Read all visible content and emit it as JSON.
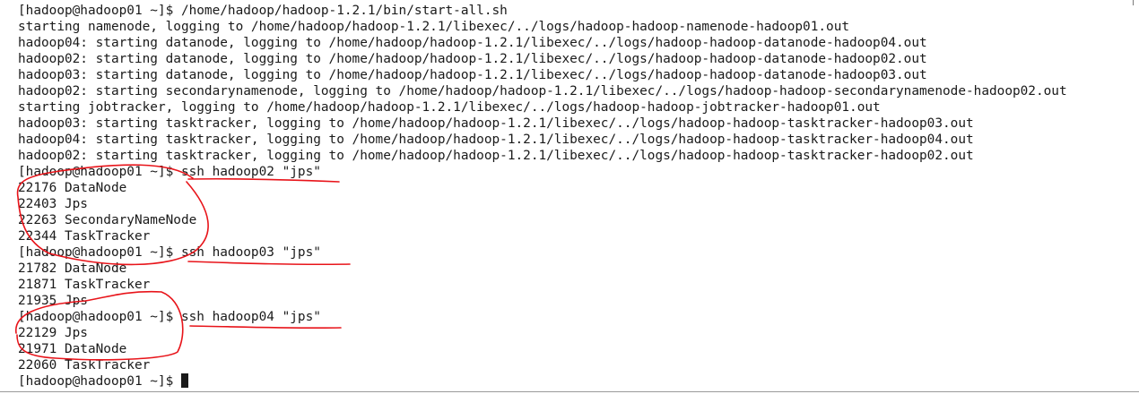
{
  "terminal": {
    "lines": [
      "[hadoop@hadoop01 ~]$ /home/hadoop/hadoop-1.2.1/bin/start-all.sh",
      "starting namenode, logging to /home/hadoop/hadoop-1.2.1/libexec/../logs/hadoop-hadoop-namenode-hadoop01.out",
      "hadoop04: starting datanode, logging to /home/hadoop/hadoop-1.2.1/libexec/../logs/hadoop-hadoop-datanode-hadoop04.out",
      "hadoop02: starting datanode, logging to /home/hadoop/hadoop-1.2.1/libexec/../logs/hadoop-hadoop-datanode-hadoop02.out",
      "hadoop03: starting datanode, logging to /home/hadoop/hadoop-1.2.1/libexec/../logs/hadoop-hadoop-datanode-hadoop03.out",
      "hadoop02: starting secondarynamenode, logging to /home/hadoop/hadoop-1.2.1/libexec/../logs/hadoop-hadoop-secondarynamenode-hadoop02.out",
      "starting jobtracker, logging to /home/hadoop/hadoop-1.2.1/libexec/../logs/hadoop-hadoop-jobtracker-hadoop01.out",
      "hadoop03: starting tasktracker, logging to /home/hadoop/hadoop-1.2.1/libexec/../logs/hadoop-hadoop-tasktracker-hadoop03.out",
      "hadoop04: starting tasktracker, logging to /home/hadoop/hadoop-1.2.1/libexec/../logs/hadoop-hadoop-tasktracker-hadoop04.out",
      "hadoop02: starting tasktracker, logging to /home/hadoop/hadoop-1.2.1/libexec/../logs/hadoop-hadoop-tasktracker-hadoop02.out",
      "[hadoop@hadoop01 ~]$ ssh hadoop02 \"jps\"",
      "22176 DataNode",
      "22403 Jps",
      "22263 SecondaryNameNode",
      "22344 TaskTracker",
      "[hadoop@hadoop01 ~]$ ssh hadoop03 \"jps\"",
      "21782 DataNode",
      "21871 TaskTracker",
      "21935 Jps",
      "[hadoop@hadoop01 ~]$ ssh hadoop04 \"jps\"",
      "22129 Jps",
      "21971 DataNode",
      "22060 TaskTracker"
    ],
    "prompt": "[hadoop@hadoop01 ~]$ "
  },
  "colors": {
    "background": "#ffffff",
    "text": "#1a1a1a",
    "annotation": "#e8141a"
  }
}
